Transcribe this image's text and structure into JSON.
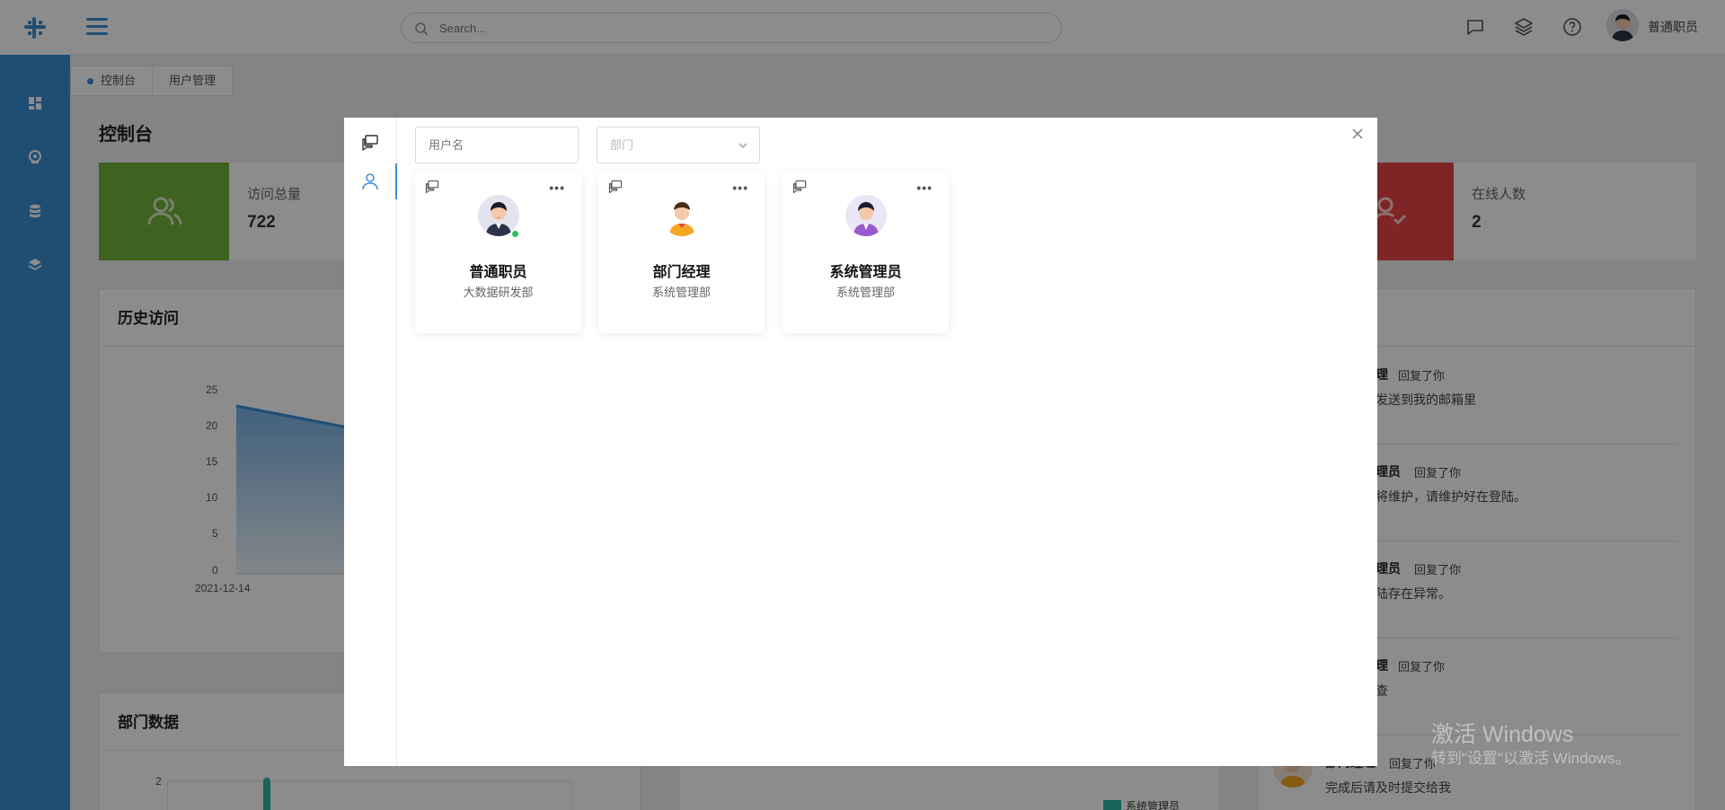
{
  "header": {
    "search_placeholder": "Search...",
    "user_name": "普通职员"
  },
  "tabs": [
    {
      "label": "控制台"
    },
    {
      "label": "用户管理"
    }
  ],
  "page_title": "控制台",
  "stats": [
    {
      "label": "访问总量",
      "value": "722",
      "color": "#71b23a"
    },
    {
      "label": "在线人数",
      "value": "2",
      "color": "#ea4444"
    }
  ],
  "history_panel": {
    "title": "历史访问",
    "y_ticks": [
      "25",
      "20",
      "15",
      "10",
      "5",
      "0"
    ],
    "x_first": "2021-12-14"
  },
  "dept_panel": {
    "title": "部门数据",
    "y_tick": "2"
  },
  "pie_panel": {
    "legend": "系统管理员"
  },
  "messages": [
    {
      "who": "理",
      "act": "回复了你",
      "text": "发送到我的邮箱里"
    },
    {
      "who": "理员",
      "act": "回复了你",
      "text": "将维护，请维护好在登陆。"
    },
    {
      "who": "理员",
      "act": "回复了你",
      "text": "陆存在异常。"
    },
    {
      "who": "理",
      "act": "回复了你",
      "text": "查"
    },
    {
      "who": "部门经理",
      "act": "回复了你",
      "text": "完成后请及时提交给我"
    }
  ],
  "modal": {
    "username_placeholder": "用户名",
    "dept_placeholder": "部门",
    "users": [
      {
        "name": "普通职员",
        "dept": "大数据研发部",
        "online": true
      },
      {
        "name": "部门经理",
        "dept": "系统管理部",
        "online": false
      },
      {
        "name": "系统管理员",
        "dept": "系统管理部",
        "online": false
      }
    ]
  },
  "watermark": {
    "line1": "激活 Windows",
    "line2": "转到\"设置\"以激活 Windows。"
  }
}
